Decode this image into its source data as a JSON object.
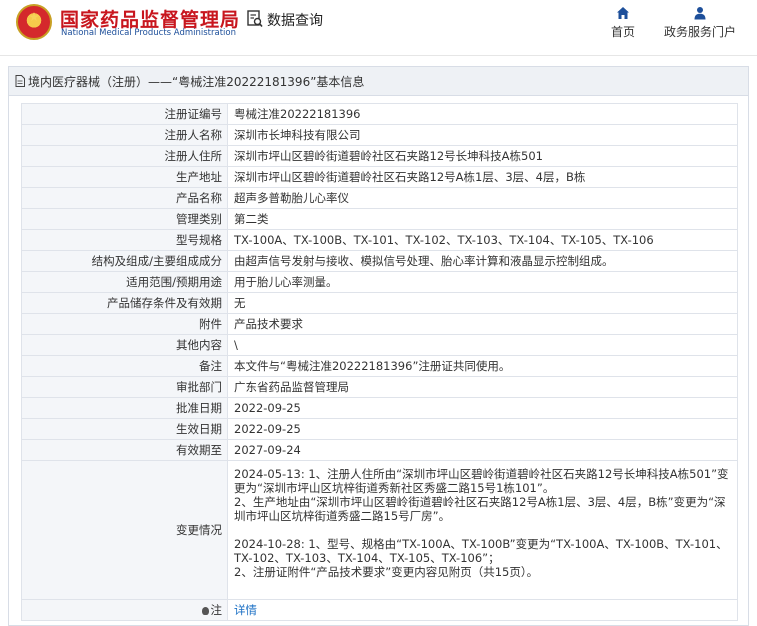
{
  "header": {
    "site_title": "国家药品监督管理局",
    "site_subtitle": "National Medical Products Administration",
    "query_label": "数据查询",
    "nav": [
      {
        "label": "首页",
        "icon": "home-icon"
      },
      {
        "label": "政务服务门户",
        "icon": "user-icon"
      }
    ]
  },
  "panel": {
    "title": "境内医疗器械（注册）——“粤械注准20222181396”基本信息"
  },
  "rows": [
    {
      "label": "注册证编号",
      "value": "粤械注准20222181396"
    },
    {
      "label": "注册人名称",
      "value": "深圳市长坤科技有限公司"
    },
    {
      "label": "注册人住所",
      "value": "深圳市坪山区碧岭街道碧岭社区石夹路12号长坤科技A栋501"
    },
    {
      "label": "生产地址",
      "value": "深圳市坪山区碧岭街道碧岭社区石夹路12号A栋1层、3层、4层，B栋"
    },
    {
      "label": "产品名称",
      "value": "超声多普勒胎儿心率仪"
    },
    {
      "label": "管理类别",
      "value": "第二类"
    },
    {
      "label": "型号规格",
      "value": "TX-100A、TX-100B、TX-101、TX-102、TX-103、TX-104、TX-105、TX-106"
    },
    {
      "label": "结构及组成/主要组成成分",
      "value": "由超声信号发射与接收、模拟信号处理、胎心率计算和液晶显示控制组成。"
    },
    {
      "label": "适用范围/预期用途",
      "value": "用于胎儿心率测量。"
    },
    {
      "label": "产品储存条件及有效期",
      "value": "无"
    },
    {
      "label": "附件",
      "value": "产品技术要求"
    },
    {
      "label": "其他内容",
      "value": "\\"
    },
    {
      "label": "备注",
      "value": "本文件与“粤械注准20222181396”注册证共同使用。"
    },
    {
      "label": "审批部门",
      "value": "广东省药品监督管理局"
    },
    {
      "label": "批准日期",
      "value": "2022-09-25"
    },
    {
      "label": "生效日期",
      "value": "2022-09-25"
    },
    {
      "label": "有效期至",
      "value": "2027-09-24"
    }
  ],
  "changes": {
    "label": "变更情况",
    "text": "2024-05-13: 1、注册人住所由“深圳市坪山区碧岭街道碧岭社区石夹路12号长坤科技A栋501”变更为“深圳市坪山区坑梓街道秀新社区秀盛二路15号1栋101”。\n2、生产地址由“深圳市坪山区碧岭街道碧岭社区石夹路12号A栋1层、3层、4层，B栋”变更为“深圳市坪山区坑梓街道秀盛二路15号厂房”。\n\n2024-10-28: 1、型号、规格由“TX-100A、TX-100B”变更为“TX-100A、TX-100B、TX-101、TX-102、TX-103、TX-104、TX-105、TX-106”；\n2、注册证附件“产品技术要求”变更内容见附页（共15页）。"
  },
  "note": {
    "label": "注",
    "link": "详情"
  }
}
